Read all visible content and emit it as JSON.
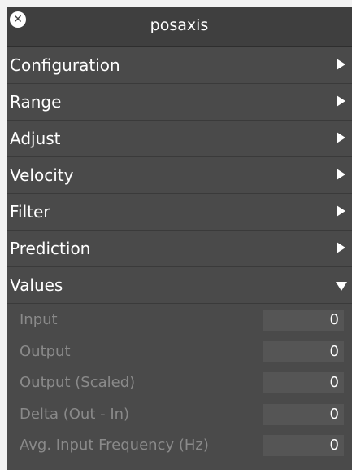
{
  "window": {
    "title": "posaxis",
    "close_glyph": "✕"
  },
  "sections": {
    "configuration": "Configuration",
    "range": "Range",
    "adjust": "Adjust",
    "velocity": "Velocity",
    "filter": "Filter",
    "prediction": "Prediction",
    "values": "Values"
  },
  "values": {
    "input": {
      "label": "Input",
      "value": "0"
    },
    "output": {
      "label": "Output",
      "value": "0"
    },
    "output_scaled": {
      "label": "Output (Scaled)",
      "value": "0"
    },
    "delta": {
      "label": "Delta (Out - In)",
      "value": "0"
    },
    "avg_freq": {
      "label": "Avg. Input Frequency (Hz)",
      "value": "0"
    }
  },
  "icons": {
    "close": "close-icon",
    "collapsed": "triangle-right-icon",
    "expanded": "triangle-down-icon"
  },
  "colors": {
    "panel_bg": "#4a4a4a",
    "title_bg": "#3f3f3f",
    "label_text": "#ffffff",
    "muted_text": "#8a8a8a",
    "value_field_bg": "#555555"
  }
}
